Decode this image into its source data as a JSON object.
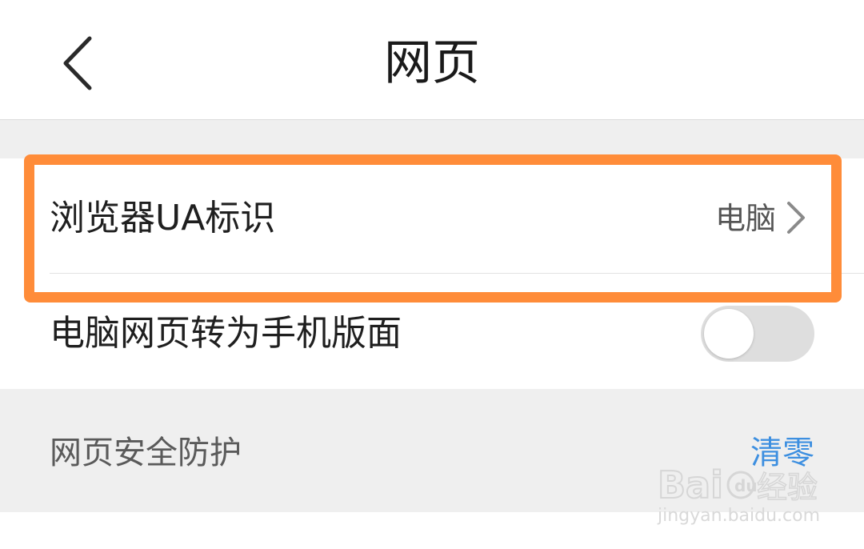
{
  "header": {
    "title": "网页",
    "back_icon": "chevron-left-icon"
  },
  "settings": {
    "ua_row": {
      "label": "浏览器UA标识",
      "value": "电脑",
      "icon": "chevron-right-icon"
    },
    "mobile_view_row": {
      "label": "电脑网页转为手机版面",
      "toggle_on": false
    }
  },
  "security_section": {
    "title": "网页安全防护",
    "action_label": "清零"
  },
  "watermark": {
    "logo_text": "Baidu经验",
    "url": "jingyan.baidu.com"
  },
  "colors": {
    "highlight": "#ff8c39",
    "link": "#3d8fe0",
    "section_bg": "#efefef"
  }
}
